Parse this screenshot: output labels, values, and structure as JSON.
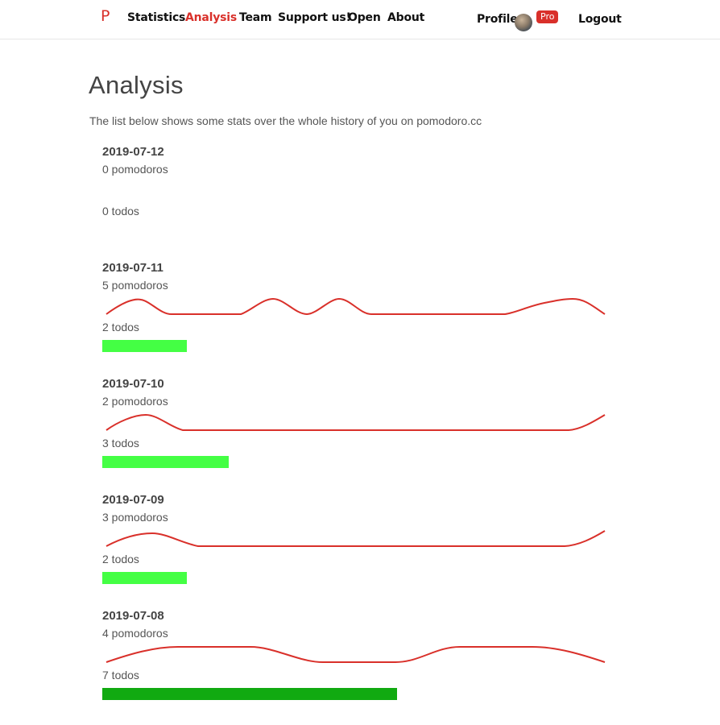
{
  "nav": {
    "brand": "P",
    "links": [
      {
        "label": "Statistics",
        "active": false
      },
      {
        "label": "Analysis",
        "active": true
      },
      {
        "label": "Team",
        "active": false
      },
      {
        "label": "Support us!",
        "active": false
      },
      {
        "label": "Open",
        "active": false
      },
      {
        "label": "About",
        "active": false
      }
    ],
    "profile_label": "Profile",
    "pro_badge": "Pro",
    "logout_label": "Logout",
    "accent_color": "#d9302a"
  },
  "page": {
    "title": "Analysis",
    "lead": "The list below shows some stats over the whole history of you on pomodoro.cc"
  },
  "days": [
    {
      "date": "2019-07-12",
      "pomodoros": "0 pomodoros",
      "todos": "0 todos",
      "todo_count": 0
    },
    {
      "date": "2019-07-11",
      "pomodoros": "5 pomodoros",
      "todos": "2 todos",
      "todo_count": 2
    },
    {
      "date": "2019-07-10",
      "pomodoros": "2 pomodoros",
      "todos": "3 todos",
      "todo_count": 3
    },
    {
      "date": "2019-07-09",
      "pomodoros": "3 pomodoros",
      "todos": "2 todos",
      "todo_count": 2
    },
    {
      "date": "2019-07-08",
      "pomodoros": "4 pomodoros",
      "todos": "7 todos",
      "todo_count": 7
    }
  ],
  "colors": {
    "sparkline": "#d9302a",
    "todo_bar_light": "#44ff44",
    "todo_bar_dark": "#11aa11"
  }
}
